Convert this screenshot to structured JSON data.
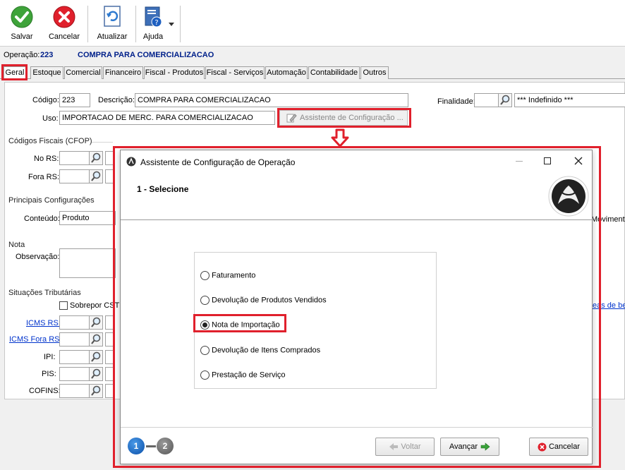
{
  "toolbar": {
    "save_label": "Salvar",
    "cancel_label": "Cancelar",
    "refresh_label": "Atualizar",
    "help_label": "Ajuda"
  },
  "operation": {
    "label": "Operação:",
    "number": "223",
    "name": "COMPRA PARA COMERCIALIZACAO"
  },
  "tabs": [
    "Geral",
    "Estoque",
    "Comercial",
    "Financeiro",
    "Fiscal - Produtos",
    "Fiscal - Serviços",
    "Automação",
    "Contabilidade",
    "Outros"
  ],
  "form": {
    "codigo_label": "Código:",
    "codigo_value": "223",
    "descricao_label": "Descrição:",
    "descricao_value": "COMPRA PARA COMERCIALIZACAO",
    "finalidade_label": "Finalidade:",
    "finalidade_value": "*** Indefinido ***",
    "uso_label": "Uso:",
    "uso_value": "IMPORTACAO DE MERC. PARA COMERCIALIZACAO",
    "assistente_button": "Assistente de Configuração ..."
  },
  "cfop": {
    "title": "Códigos Fiscais (CFOP)",
    "no_rs_label": "No RS:",
    "fora_rs_label": "Fora RS:"
  },
  "config": {
    "title": "Principais Configurações",
    "conteudo_label": "Conteúdo:",
    "conteudo_value": "Produto",
    "right_clip": "Moviment"
  },
  "nota": {
    "title": "Nota",
    "observacao_label": "Observação:"
  },
  "situacoes": {
    "title": "Situações Tributárias",
    "sobrepor_label": "Sobrepor CST",
    "right_link_clip": "eas de be",
    "icms_rs": "ICMS RS:",
    "icms_fora_rs": "ICMS Fora RS:",
    "ipi": "IPI:",
    "pis": "PIS:",
    "cofins": "COFINS:"
  },
  "dialog": {
    "title": "Assistente de Configuração de Operação",
    "step_title": "1 - Selecione",
    "options": [
      "Faturamento",
      "Devolução de Produtos Vendidos",
      "Nota de Importação",
      "Devolução de Itens Comprados",
      "Prestação de Serviço"
    ],
    "selected_index": 2,
    "step1": "1",
    "step2": "2",
    "back_label": "Voltar",
    "next_label": "Avançar",
    "cancel_label": "Cancelar"
  },
  "colors": {
    "highlight": "#e0202c",
    "operation_name": "#00208a",
    "link": "#0033cc"
  }
}
